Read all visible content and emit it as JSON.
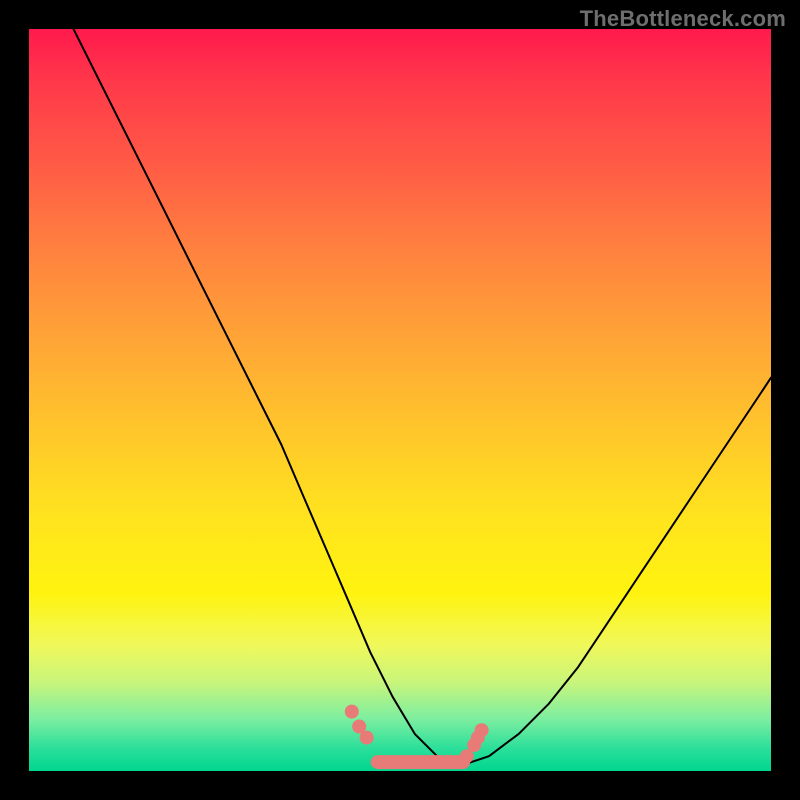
{
  "watermark": "TheBottleneck.com",
  "chart_data": {
    "type": "line",
    "title": "",
    "xlabel": "",
    "ylabel": "",
    "xlim": [
      0,
      100
    ],
    "ylim": [
      0,
      100
    ],
    "grid": false,
    "legend": false,
    "series": [
      {
        "name": "bottleneck-curve",
        "x": [
          6,
          10,
          14,
          18,
          22,
          26,
          30,
          34,
          37,
          40,
          43,
          46,
          49,
          52,
          55,
          57,
          59,
          62,
          66,
          70,
          74,
          78,
          82,
          86,
          90,
          94,
          98,
          100
        ],
        "y": [
          100,
          92,
          84,
          76,
          68,
          60,
          52,
          44,
          37,
          30,
          23,
          16,
          10,
          5,
          2,
          1,
          1,
          2,
          5,
          9,
          14,
          20,
          26,
          32,
          38,
          44,
          50,
          53
        ]
      }
    ],
    "markers": {
      "name": "highlight-dots",
      "x": [
        43.5,
        44.5,
        45.5,
        59.0,
        60.0,
        60.5,
        61.0
      ],
      "y": [
        8.0,
        6.0,
        4.5,
        2.0,
        3.5,
        4.5,
        5.5
      ]
    },
    "flat_segment": {
      "name": "bottom-worm",
      "x": [
        47,
        58.5
      ],
      "y": [
        1.2,
        1.2
      ]
    },
    "colors": {
      "curve": "#000000",
      "marker": "#e87a77",
      "gradient_top": "#ff1a4d",
      "gradient_bottom": "#00d68f"
    }
  }
}
